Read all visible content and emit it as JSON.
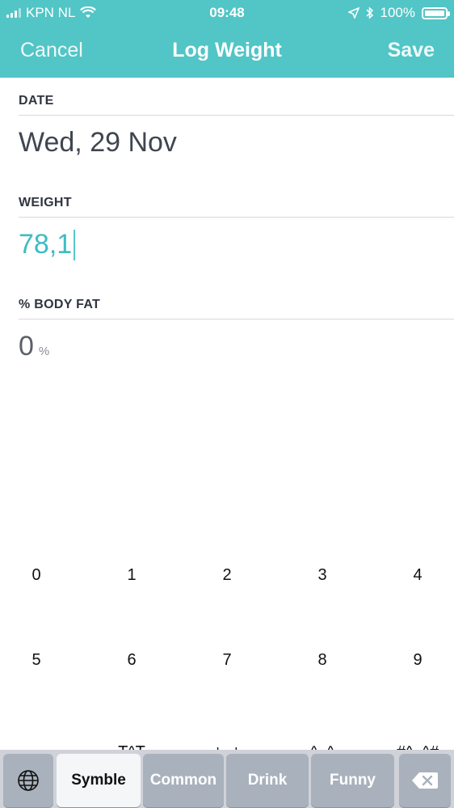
{
  "status_bar": {
    "carrier": "KPN NL",
    "time": "09:48",
    "battery": "100%",
    "battery_level": 1.0
  },
  "nav": {
    "cancel": "Cancel",
    "title": "Log Weight",
    "save": "Save"
  },
  "fields": {
    "date_label": "DATE",
    "date_value": "Wed, 29 Nov",
    "weight_label": "WEIGHT",
    "weight_value": "78,1",
    "fat_label": "% BODY FAT",
    "fat_value": "0",
    "fat_unit": "%"
  },
  "keypad": {
    "row1": [
      "0",
      "1",
      "2",
      "3",
      "4"
    ],
    "row2": [
      "5",
      "6",
      "7",
      "8",
      "9"
    ],
    "row3_partial": [
      "-_-",
      "T^T",
      "+_+",
      "^_^",
      "#^_^#"
    ]
  },
  "keyboard_bar": {
    "symble": "Symble",
    "common": "Common",
    "drink": "Drink",
    "funny": "Funny"
  },
  "colors": {
    "accent": "#52c5c6",
    "weight_text": "#3fbcc2"
  }
}
